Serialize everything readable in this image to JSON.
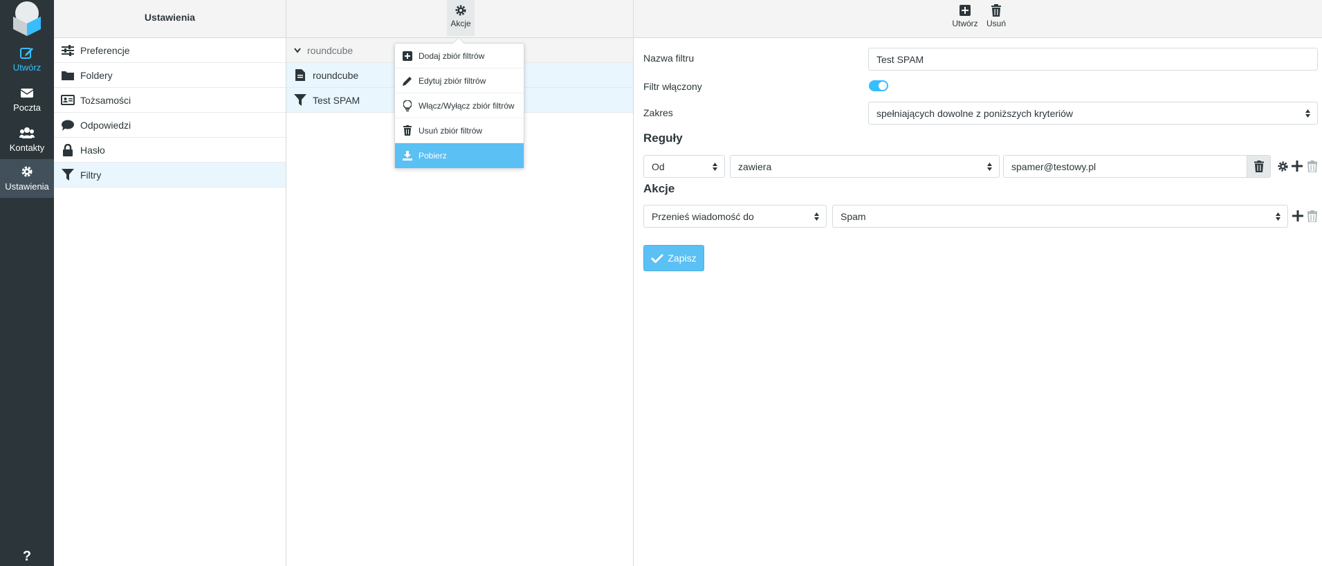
{
  "nav": {
    "items": [
      {
        "label": "Utwórz",
        "icon": "compose-icon"
      },
      {
        "label": "Poczta",
        "icon": "mail-icon"
      },
      {
        "label": "Kontakty",
        "icon": "contacts-icon"
      },
      {
        "label": "Ustawienia",
        "icon": "settings-icon"
      }
    ],
    "help": "?"
  },
  "settings": {
    "title": "Ustawienia",
    "items": [
      {
        "label": "Preferencje",
        "icon": "sliders-icon"
      },
      {
        "label": "Foldery",
        "icon": "folder-icon"
      },
      {
        "label": "Tożsamości",
        "icon": "id-card-icon"
      },
      {
        "label": "Odpowiedzi",
        "icon": "comment-icon"
      },
      {
        "label": "Hasło",
        "icon": "lock-icon"
      },
      {
        "label": "Filtry",
        "icon": "filter-icon"
      }
    ]
  },
  "filtersets": {
    "actions_label": "Akcje",
    "group_label": "roundcube",
    "set_label": "roundcube",
    "filter_label": "Test SPAM"
  },
  "menu": {
    "items": [
      {
        "label": "Dodaj zbiór filtrów",
        "icon": "plus-square-icon"
      },
      {
        "label": "Edytuj zbiór filtrów",
        "icon": "pencil-icon"
      },
      {
        "label": "Włącz/Wyłącz zbiór filtrów",
        "icon": "lightbulb-icon"
      },
      {
        "label": "Usuń zbiór filtrów",
        "icon": "trash-icon"
      },
      {
        "label": "Pobierz",
        "icon": "download-icon"
      }
    ]
  },
  "toolbar": {
    "create_label": "Utwórz",
    "delete_label": "Usuń"
  },
  "form": {
    "name_label": "Nazwa filtru",
    "name_value": "Test SPAM",
    "enabled_label": "Filtr włączony",
    "enabled": true,
    "scope_label": "Zakres",
    "scope_value": "spełniających dowolne z poniższych kryteriów",
    "rules_title": "Reguły",
    "rule_header": "Od",
    "rule_op": "zawiera",
    "rule_target": "spamer@testowy.pl",
    "actions_title": "Akcje",
    "action_type": "Przenieś wiadomość do",
    "action_target": "Spam",
    "save_label": "Zapisz"
  },
  "colors": {
    "accent": "#37beff",
    "nav_bg": "#2c363a",
    "active_menu": "#5bc0f4"
  }
}
